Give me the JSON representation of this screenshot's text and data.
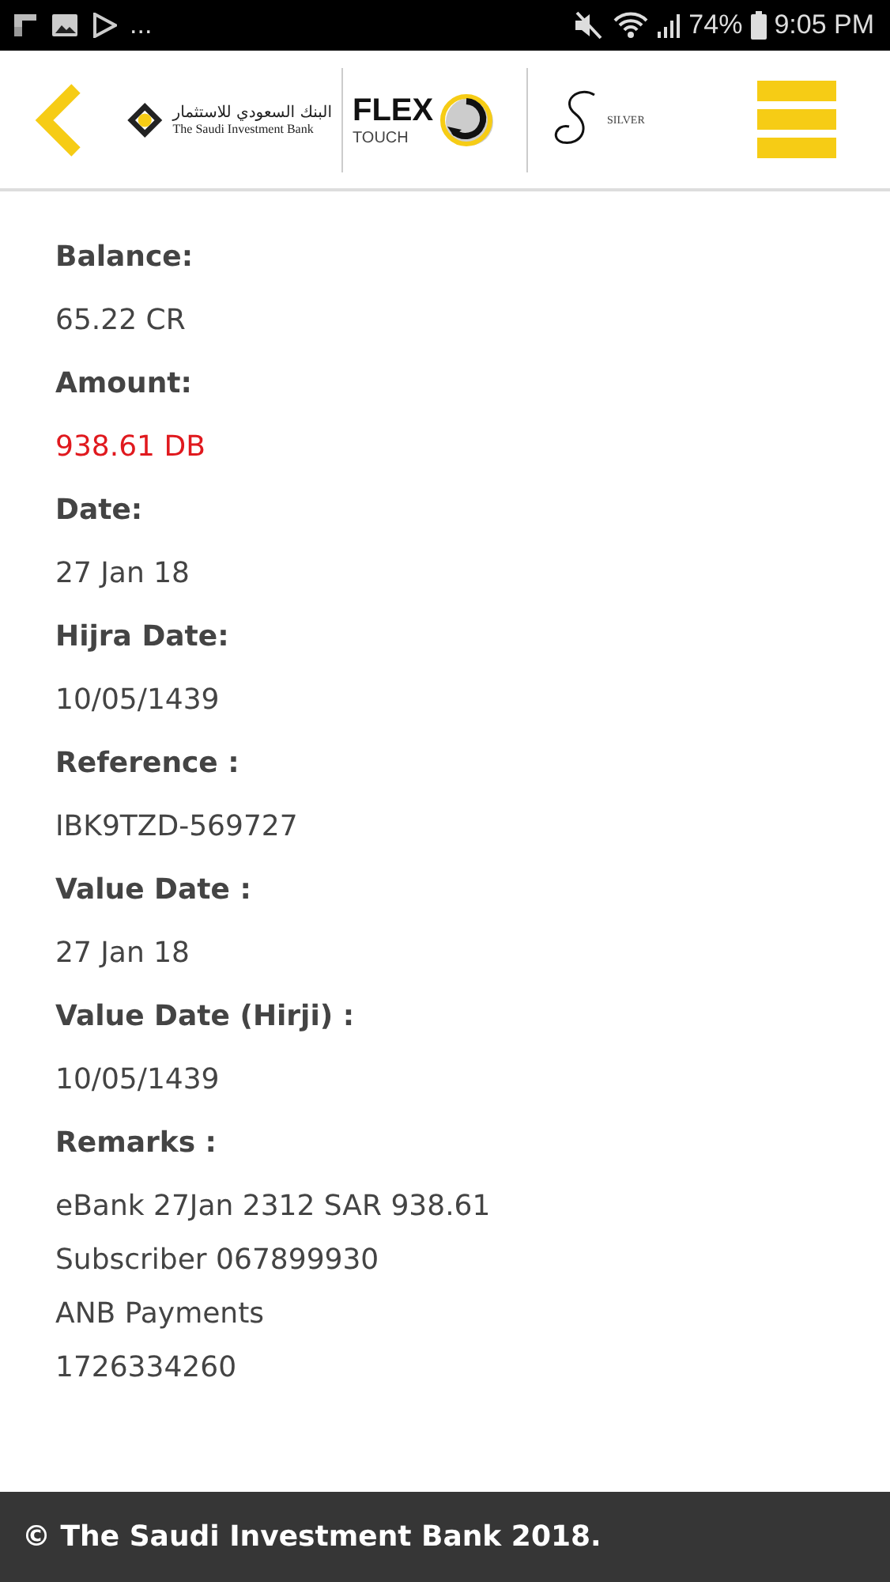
{
  "status_bar": {
    "overflow": "...",
    "battery": "74%",
    "time": "9:05 PM"
  },
  "header": {
    "bank_name_arabic": "البنك السعودي للاستثمار",
    "bank_name": "The Saudi Investment Bank",
    "flex": "FLEX",
    "touch": "TOUCH",
    "silver": "SILVER"
  },
  "fields": [
    {
      "label": "Balance:",
      "lines": [
        "65.22 CR"
      ]
    },
    {
      "label": "Amount:",
      "lines": [
        "938.61 DB"
      ],
      "color": "#e0191e"
    },
    {
      "label": "Date:",
      "lines": [
        "27 Jan 18"
      ]
    },
    {
      "label": "Hijra Date:",
      "lines": [
        "10/05/1439"
      ]
    },
    {
      "label": "Reference :",
      "lines": [
        "IBK9TZD-569727"
      ]
    },
    {
      "label": "Value Date :",
      "lines": [
        "27 Jan 18"
      ]
    },
    {
      "label": "Value Date (Hirji) :",
      "lines": [
        "10/05/1439"
      ]
    },
    {
      "label": "Remarks :",
      "lines": [
        "eBank 27Jan 2312 SAR 938.61",
        "Subscriber 067899930",
        "ANB Payments",
        "1726334260"
      ]
    }
  ],
  "footer": "© The Saudi Investment Bank 2018."
}
